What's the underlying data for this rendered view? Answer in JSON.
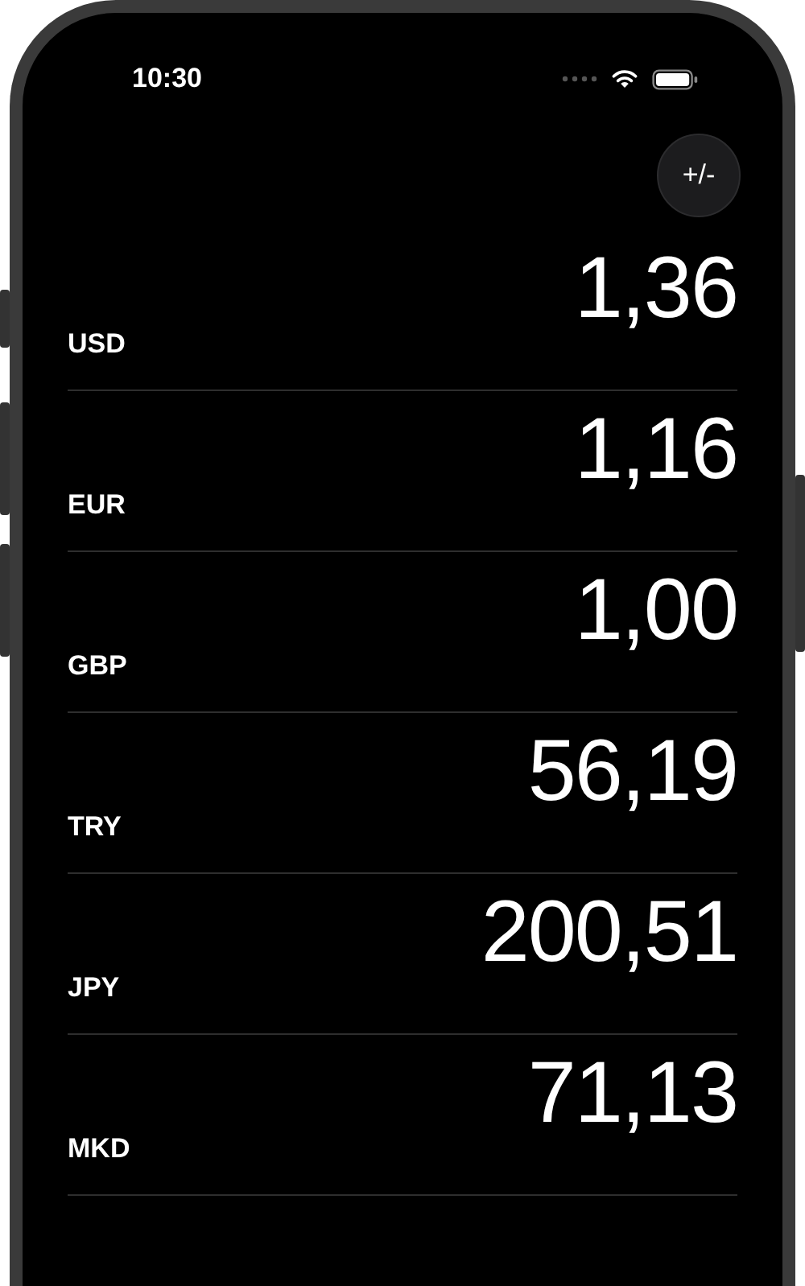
{
  "status_bar": {
    "time": "10:30"
  },
  "toggle_button": {
    "label": "+/-"
  },
  "currencies": [
    {
      "code": "USD",
      "value": "1,36"
    },
    {
      "code": "EUR",
      "value": "1,16"
    },
    {
      "code": "GBP",
      "value": "1,00"
    },
    {
      "code": "TRY",
      "value": "56,19"
    },
    {
      "code": "JPY",
      "value": "200,51"
    },
    {
      "code": "MKD",
      "value": "71,13"
    }
  ]
}
